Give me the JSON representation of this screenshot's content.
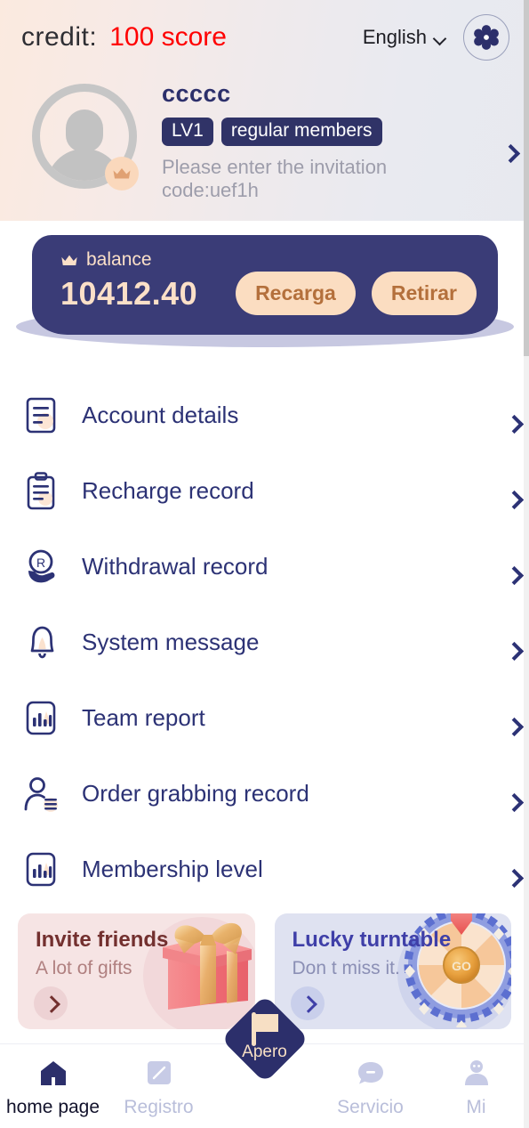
{
  "header": {
    "credit_label": "credit:",
    "credit_value": "100 score",
    "language": "English",
    "settings_icon": "gear-icon"
  },
  "profile": {
    "username": "ccccc",
    "level_badge": "LV1",
    "member_badge": "regular members",
    "invite_code_text": "Please enter the invitation code:uef1h",
    "avatar_icon": "default-avatar-icon",
    "crown_icon": "crown-icon"
  },
  "balance": {
    "title": "balance",
    "amount": "10412.40",
    "recharge_label": "Recarga",
    "withdraw_label": "Retirar",
    "crown_icon": "crown-icon"
  },
  "menu": {
    "items": [
      {
        "label": "Account details",
        "icon": "document-lines-icon"
      },
      {
        "label": "Recharge record",
        "icon": "clipboard-icon"
      },
      {
        "label": "Withdrawal record",
        "icon": "hand-coin-icon"
      },
      {
        "label": "System message",
        "icon": "bell-icon"
      },
      {
        "label": "Team report",
        "icon": "bar-chart-icon"
      },
      {
        "label": "Order grabbing record",
        "icon": "person-list-icon"
      },
      {
        "label": "Membership level",
        "icon": "bar-chart-icon"
      }
    ]
  },
  "promos": [
    {
      "title": "Invite friends",
      "subtitle": "A lot of gifts",
      "art": "gift-box-art",
      "accent": "#73302F",
      "background": "#F6E4E4"
    },
    {
      "title": "Lucky turntable",
      "subtitle": "Don t miss it.",
      "art": "fortune-wheel-art",
      "accent": "#3F3FA8",
      "background": "#DFE2F1"
    }
  ],
  "wheel": {
    "go_label": "GO"
  },
  "tabbar": {
    "items": [
      {
        "label": "home page",
        "icon": "home-icon",
        "active": true
      },
      {
        "label": "Registro",
        "icon": "note-edit-icon",
        "active": false
      },
      {
        "label": "Servicio",
        "icon": "chat-bubble-icon",
        "active": false
      },
      {
        "label": "Mi",
        "icon": "person-icon",
        "active": false
      }
    ],
    "center": {
      "label": "Apero",
      "icon": "flag-icon"
    }
  },
  "colors": {
    "navy": "#3A3C77",
    "navy_text": "#2C3275",
    "peach": "#FBE0C8",
    "red": "#FF0000",
    "muted": "#9d9dab"
  }
}
